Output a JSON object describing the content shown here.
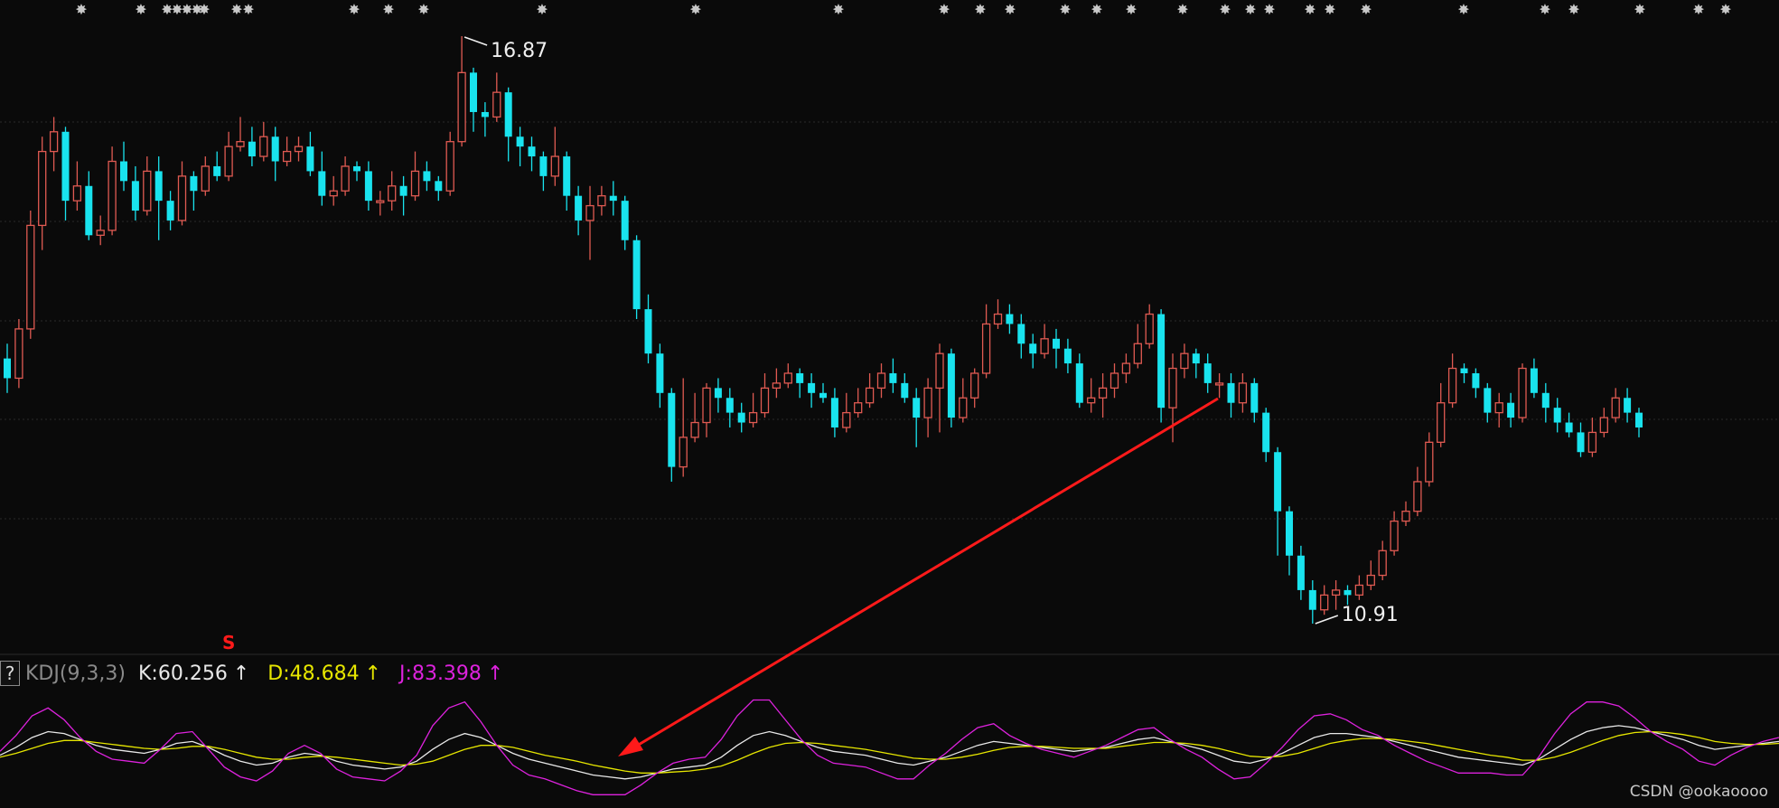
{
  "chart_data": [
    {
      "type": "candlestick",
      "title": "",
      "annotations": [
        {
          "text": "16.87",
          "kind": "high"
        },
        {
          "text": "10.91",
          "kind": "low"
        }
      ],
      "signal_marker": "S",
      "colors": {
        "up": "#e05a52",
        "down": "#19e3ee",
        "grid": "#2a2a2a",
        "arrow": "#ff1a1a"
      },
      "candles": [
        [
          13.6,
          13.4,
          13.75,
          13.25
        ],
        [
          13.4,
          13.9,
          14.0,
          13.3
        ],
        [
          13.9,
          14.95,
          15.1,
          13.8
        ],
        [
          14.95,
          15.7,
          15.85,
          14.7
        ],
        [
          15.7,
          15.9,
          16.05,
          15.5
        ],
        [
          15.9,
          15.2,
          15.95,
          15.0
        ],
        [
          15.2,
          15.35,
          15.6,
          15.1
        ],
        [
          15.35,
          14.85,
          15.5,
          14.8
        ],
        [
          14.85,
          14.9,
          15.05,
          14.75
        ],
        [
          14.9,
          15.6,
          15.75,
          14.85
        ],
        [
          15.6,
          15.4,
          15.8,
          15.3
        ],
        [
          15.4,
          15.1,
          15.55,
          15.0
        ],
        [
          15.1,
          15.5,
          15.65,
          15.05
        ],
        [
          15.5,
          15.2,
          15.65,
          14.8
        ],
        [
          15.2,
          15.0,
          15.3,
          14.9
        ],
        [
          15.0,
          15.45,
          15.6,
          14.95
        ],
        [
          15.45,
          15.3,
          15.5,
          15.1
        ],
        [
          15.3,
          15.55,
          15.65,
          15.25
        ],
        [
          15.55,
          15.45,
          15.7,
          15.4
        ],
        [
          15.45,
          15.75,
          15.9,
          15.4
        ],
        [
          15.75,
          15.8,
          16.05,
          15.7
        ],
        [
          15.8,
          15.65,
          15.95,
          15.55
        ],
        [
          15.65,
          15.85,
          16.0,
          15.6
        ],
        [
          15.85,
          15.6,
          15.95,
          15.4
        ],
        [
          15.6,
          15.7,
          15.85,
          15.55
        ],
        [
          15.7,
          15.75,
          15.85,
          15.6
        ],
        [
          15.75,
          15.5,
          15.9,
          15.45
        ],
        [
          15.5,
          15.25,
          15.7,
          15.15
        ],
        [
          15.25,
          15.3,
          15.45,
          15.15
        ],
        [
          15.3,
          15.55,
          15.65,
          15.25
        ],
        [
          15.55,
          15.5,
          15.6,
          15.4
        ],
        [
          15.5,
          15.2,
          15.6,
          15.1
        ],
        [
          15.2,
          15.2,
          15.3,
          15.05
        ],
        [
          15.2,
          15.35,
          15.5,
          15.1
        ],
        [
          15.35,
          15.25,
          15.45,
          15.05
        ],
        [
          15.25,
          15.5,
          15.7,
          15.2
        ],
        [
          15.5,
          15.4,
          15.6,
          15.3
        ],
        [
          15.4,
          15.3,
          15.45,
          15.2
        ],
        [
          15.3,
          15.8,
          15.9,
          15.25
        ],
        [
          15.8,
          16.5,
          16.87,
          15.75
        ],
        [
          16.5,
          16.1,
          16.55,
          15.9
        ],
        [
          16.1,
          16.05,
          16.2,
          15.85
        ],
        [
          16.05,
          16.3,
          16.5,
          16.0
        ],
        [
          16.3,
          15.85,
          16.35,
          15.6
        ],
        [
          15.85,
          15.75,
          15.95,
          15.55
        ],
        [
          15.75,
          15.65,
          15.85,
          15.5
        ],
        [
          15.65,
          15.45,
          15.7,
          15.3
        ],
        [
          15.45,
          15.65,
          15.95,
          15.35
        ],
        [
          15.65,
          15.25,
          15.7,
          15.1
        ],
        [
          15.25,
          15.0,
          15.35,
          14.85
        ],
        [
          15.0,
          15.15,
          15.35,
          14.6
        ],
        [
          15.15,
          15.25,
          15.35,
          15.05
        ],
        [
          15.25,
          15.2,
          15.4,
          15.05
        ],
        [
          15.2,
          14.8,
          15.25,
          14.7
        ],
        [
          14.8,
          14.1,
          14.85,
          14.0
        ],
        [
          14.1,
          13.65,
          14.25,
          13.55
        ],
        [
          13.65,
          13.25,
          13.75,
          13.1
        ],
        [
          13.25,
          12.5,
          13.3,
          12.35
        ],
        [
          12.5,
          12.8,
          13.4,
          12.4
        ],
        [
          12.8,
          12.95,
          13.25,
          12.75
        ],
        [
          12.95,
          13.3,
          13.35,
          12.8
        ],
        [
          13.3,
          13.2,
          13.4,
          13.05
        ],
        [
          13.2,
          13.05,
          13.3,
          12.9
        ],
        [
          13.05,
          12.95,
          13.15,
          12.85
        ],
        [
          12.95,
          13.05,
          13.25,
          12.9
        ],
        [
          13.05,
          13.3,
          13.45,
          13.0
        ],
        [
          13.3,
          13.35,
          13.5,
          13.2
        ],
        [
          13.35,
          13.45,
          13.55,
          13.3
        ],
        [
          13.45,
          13.35,
          13.5,
          13.2
        ],
        [
          13.35,
          13.25,
          13.45,
          13.1
        ],
        [
          13.25,
          13.2,
          13.35,
          13.15
        ],
        [
          13.2,
          12.9,
          13.3,
          12.8
        ],
        [
          12.9,
          13.05,
          13.25,
          12.85
        ],
        [
          13.05,
          13.15,
          13.3,
          13.0
        ],
        [
          13.15,
          13.3,
          13.45,
          13.1
        ],
        [
          13.3,
          13.45,
          13.55,
          13.2
        ],
        [
          13.45,
          13.35,
          13.6,
          13.25
        ],
        [
          13.35,
          13.2,
          13.45,
          13.15
        ],
        [
          13.2,
          13.0,
          13.3,
          12.7
        ],
        [
          13.0,
          13.3,
          13.4,
          12.8
        ],
        [
          13.3,
          13.65,
          13.75,
          12.85
        ],
        [
          13.65,
          13.0,
          13.7,
          12.9
        ],
        [
          13.0,
          13.2,
          13.4,
          12.95
        ],
        [
          13.2,
          13.45,
          13.5,
          13.1
        ],
        [
          13.45,
          13.95,
          14.15,
          13.4
        ],
        [
          13.95,
          14.05,
          14.2,
          13.9
        ],
        [
          14.05,
          13.95,
          14.15,
          13.85
        ],
        [
          13.95,
          13.75,
          14.05,
          13.6
        ],
        [
          13.75,
          13.65,
          13.85,
          13.5
        ],
        [
          13.65,
          13.8,
          13.95,
          13.6
        ],
        [
          13.8,
          13.7,
          13.9,
          13.5
        ],
        [
          13.7,
          13.55,
          13.8,
          13.45
        ],
        [
          13.55,
          13.15,
          13.65,
          13.1
        ],
        [
          13.15,
          13.2,
          13.4,
          13.05
        ],
        [
          13.2,
          13.3,
          13.45,
          13.0
        ],
        [
          13.3,
          13.45,
          13.55,
          13.2
        ],
        [
          13.45,
          13.55,
          13.65,
          13.35
        ],
        [
          13.55,
          13.75,
          13.95,
          13.5
        ],
        [
          13.75,
          14.05,
          14.15,
          13.7
        ],
        [
          14.05,
          13.1,
          14.1,
          12.95
        ],
        [
          13.1,
          13.5,
          13.65,
          12.75
        ],
        [
          13.5,
          13.65,
          13.75,
          13.4
        ],
        [
          13.65,
          13.55,
          13.7,
          13.4
        ],
        [
          13.55,
          13.35,
          13.65,
          13.25
        ],
        [
          13.35,
          13.35,
          13.45,
          13.2
        ],
        [
          13.35,
          13.15,
          13.45,
          13.0
        ],
        [
          13.15,
          13.35,
          13.45,
          13.05
        ],
        [
          13.35,
          13.05,
          13.4,
          12.95
        ],
        [
          13.05,
          12.65,
          13.1,
          12.55
        ],
        [
          12.65,
          12.05,
          12.7,
          11.6
        ],
        [
          12.05,
          11.6,
          12.1,
          11.4
        ],
        [
          11.6,
          11.25,
          11.7,
          11.15
        ],
        [
          11.25,
          11.05,
          11.35,
          10.91
        ],
        [
          11.05,
          11.2,
          11.3,
          11.0
        ],
        [
          11.2,
          11.25,
          11.35,
          11.05
        ],
        [
          11.25,
          11.2,
          11.3,
          11.1
        ],
        [
          11.2,
          11.3,
          11.4,
          11.15
        ],
        [
          11.3,
          11.4,
          11.55,
          11.25
        ],
        [
          11.4,
          11.65,
          11.75,
          11.35
        ],
        [
          11.65,
          11.95,
          12.05,
          11.6
        ],
        [
          11.95,
          12.05,
          12.15,
          11.9
        ],
        [
          12.05,
          12.35,
          12.5,
          12.0
        ],
        [
          12.35,
          12.75,
          12.85,
          12.3
        ],
        [
          12.75,
          13.15,
          13.35,
          12.7
        ],
        [
          13.15,
          13.5,
          13.65,
          13.1
        ],
        [
          13.5,
          13.45,
          13.55,
          13.35
        ],
        [
          13.45,
          13.3,
          13.5,
          13.2
        ],
        [
          13.3,
          13.05,
          13.35,
          12.95
        ],
        [
          13.05,
          13.15,
          13.25,
          12.9
        ],
        [
          13.15,
          13.0,
          13.25,
          12.9
        ],
        [
          13.0,
          13.5,
          13.55,
          12.95
        ],
        [
          13.5,
          13.25,
          13.6,
          13.2
        ],
        [
          13.25,
          13.1,
          13.35,
          12.95
        ],
        [
          13.1,
          12.95,
          13.2,
          12.85
        ],
        [
          12.95,
          12.85,
          13.05,
          12.8
        ],
        [
          12.85,
          12.65,
          12.95,
          12.6
        ],
        [
          12.65,
          12.85,
          13.0,
          12.6
        ],
        [
          12.85,
          13.0,
          13.1,
          12.8
        ],
        [
          13.0,
          13.2,
          13.3,
          12.95
        ],
        [
          13.2,
          13.05,
          13.3,
          12.95
        ],
        [
          13.05,
          12.9,
          13.1,
          12.8
        ]
      ]
    },
    {
      "type": "line",
      "title": "KDJ(9,3,3)",
      "series": [
        {
          "name": "K",
          "color": "#e8e8e8",
          "values": [
            48,
            56,
            66,
            72,
            70,
            64,
            58,
            54,
            52,
            50,
            54,
            60,
            62,
            56,
            48,
            42,
            38,
            40,
            46,
            50,
            48,
            42,
            38,
            36,
            34,
            36,
            42,
            54,
            64,
            70,
            66,
            58,
            50,
            44,
            40,
            36,
            32,
            28,
            26,
            24,
            26,
            30,
            34,
            36,
            38,
            46,
            58,
            68,
            72,
            68,
            62,
            56,
            52,
            50,
            48,
            44,
            40,
            38,
            42,
            46,
            52,
            58,
            62,
            60,
            58,
            56,
            54,
            52,
            54,
            56,
            60,
            64,
            66,
            62,
            58,
            54,
            48,
            42,
            40,
            44,
            50,
            58,
            66,
            70,
            70,
            68,
            66,
            62,
            58,
            54,
            50,
            46,
            44,
            42,
            40,
            38,
            44,
            54,
            64,
            72,
            76,
            78,
            76,
            72,
            68,
            64,
            58,
            54,
            56,
            58,
            60,
            62
          ]
        },
        {
          "name": "D",
          "color": "#e6e600",
          "values": [
            46,
            50,
            55,
            60,
            63,
            63,
            61,
            59,
            57,
            55,
            54,
            55,
            57,
            57,
            54,
            50,
            46,
            44,
            44,
            46,
            47,
            46,
            44,
            42,
            40,
            38,
            39,
            42,
            48,
            54,
            58,
            58,
            56,
            52,
            48,
            45,
            42,
            38,
            35,
            32,
            30,
            30,
            31,
            32,
            34,
            37,
            43,
            50,
            56,
            60,
            61,
            60,
            58,
            56,
            54,
            51,
            48,
            45,
            44,
            44,
            46,
            49,
            53,
            56,
            57,
            57,
            56,
            55,
            55,
            55,
            57,
            59,
            61,
            61,
            60,
            58,
            55,
            51,
            47,
            46,
            47,
            50,
            55,
            60,
            63,
            65,
            65,
            64,
            62,
            60,
            57,
            54,
            51,
            48,
            46,
            43,
            43,
            46,
            51,
            57,
            63,
            68,
            71,
            72,
            71,
            69,
            66,
            62,
            60,
            59,
            59,
            60
          ]
        },
        {
          "name": "J",
          "color": "#dd22dd",
          "values": [
            52,
            68,
            88,
            96,
            84,
            66,
            52,
            44,
            42,
            40,
            54,
            70,
            72,
            54,
            36,
            26,
            22,
            32,
            50,
            58,
            50,
            34,
            26,
            24,
            22,
            32,
            48,
            78,
            96,
            102,
            82,
            58,
            38,
            28,
            24,
            18,
            12,
            8,
            8,
            8,
            18,
            30,
            40,
            44,
            46,
            64,
            88,
            104,
            104,
            84,
            64,
            48,
            40,
            38,
            36,
            30,
            24,
            24,
            38,
            50,
            64,
            76,
            80,
            68,
            60,
            54,
            50,
            46,
            52,
            58,
            66,
            74,
            76,
            64,
            54,
            46,
            34,
            24,
            26,
            40,
            56,
            74,
            88,
            90,
            84,
            74,
            68,
            58,
            50,
            42,
            36,
            30,
            30,
            30,
            28,
            28,
            46,
            70,
            90,
            102,
            102,
            98,
            86,
            72,
            62,
            54,
            42,
            38,
            48,
            56,
            62,
            66
          ]
        }
      ],
      "values_text": {
        "K": "K:60.256",
        "D": "D:48.684",
        "J": "J:83.398"
      }
    }
  ],
  "kdj": {
    "help_button": "?",
    "name": "KDJ(9,3,3)",
    "k_label": "K:60.256",
    "d_label": "D:48.684",
    "j_label": "J:83.398",
    "arrow_glyph": "↑"
  },
  "watermark": "CSDN @ookaoooo"
}
